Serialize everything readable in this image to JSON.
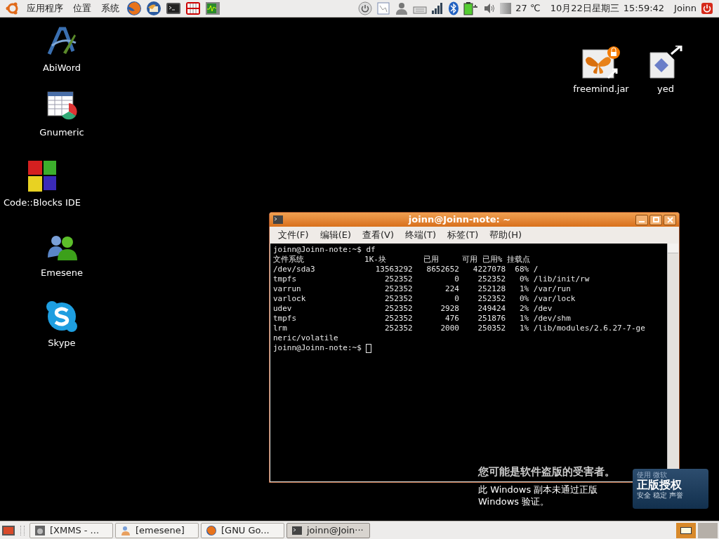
{
  "top_panel": {
    "menus": [
      "应用程序",
      "位置",
      "系统"
    ],
    "launchers": [
      {
        "kind": "firefox"
      },
      {
        "kind": "thunderbird"
      },
      {
        "kind": "terminal"
      },
      {
        "kind": "teeth"
      },
      {
        "kind": "monitor"
      }
    ],
    "temperature": "27 ℃",
    "date": "10月22日星期三",
    "time": "15:59:42",
    "user": "Joinn"
  },
  "desktop_icons": [
    {
      "label": "AbiWord",
      "kind": "abiword"
    },
    {
      "label": "Gnumeric",
      "kind": "gnumeric"
    },
    {
      "label": "Code::Blocks IDE",
      "kind": "codeblocks"
    },
    {
      "label": "Emesene",
      "kind": "emesene"
    },
    {
      "label": "Skype",
      "kind": "skype"
    },
    {
      "label": "freemind.jar",
      "kind": "freemind"
    },
    {
      "label": "yed",
      "kind": "yed"
    }
  ],
  "terminal": {
    "title": "joinn@Joinn-note: ~",
    "menus": [
      "文件(F)",
      "编辑(E)",
      "查看(V)",
      "终端(T)",
      "标签(T)",
      "帮助(H)"
    ],
    "lines": [
      "joinn@Joinn-note:~$ df",
      "文件系统             1K-块        已用     可用 已用% 挂载点",
      "/dev/sda3             13563292   8652652   4227078  68% /",
      "tmpfs                   252352         0    252352   0% /lib/init/rw",
      "varrun                  252352       224    252128   1% /var/run",
      "varlock                 252352         0    252352   0% /var/lock",
      "udev                    252352      2928    249424   2% /dev",
      "tmpfs                   252352       476    251876   1% /dev/shm",
      "lrm                     252352      2000    250352   1% /lib/modules/2.6.27-7-ge",
      "neric/volatile",
      "joinn@Joinn-note:~$ "
    ]
  },
  "notice": {
    "heading": "您可能是软件盗版的受害者。",
    "body": "此 Windows 副本未通过正版 Windows 验证。",
    "badge_top": "使用 微软",
    "badge_title": "正版授权",
    "badge_caption": "安全 稳定 声誉"
  },
  "taskbar": {
    "tasks": [
      {
        "label": "[XMMS - ...",
        "kind": "xmms",
        "selected": false
      },
      {
        "label": "[emesene]",
        "kind": "emesene",
        "selected": false
      },
      {
        "label": "[GNU Go...",
        "kind": "firefox",
        "selected": false
      },
      {
        "label": "joinn@Join···",
        "kind": "terminal",
        "selected": true
      }
    ],
    "workspaces": [
      {
        "selected": true
      },
      {
        "selected": false
      }
    ]
  }
}
